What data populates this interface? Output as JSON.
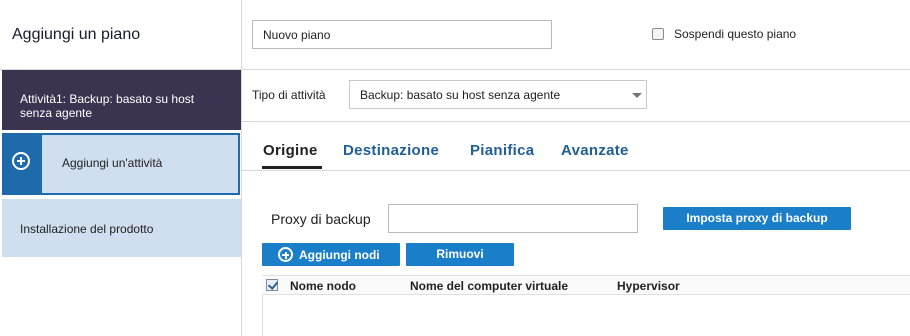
{
  "left_panel": {
    "title": "Aggiungi un piano",
    "task_item": "Attività1: Backup: basato su host senza agente",
    "add_task": "Aggiungi un'attività",
    "install": "Installazione del prodotto"
  },
  "header": {
    "plan_name_value": "Nuovo piano",
    "suspend_label": "Sospendi questo piano",
    "suspend_checked": false
  },
  "task_type": {
    "label": "Tipo di attività",
    "selected": "Backup: basato su host senza agente"
  },
  "tabs": [
    {
      "label": "Origine",
      "active": true
    },
    {
      "label": "Destinazione",
      "active": false
    },
    {
      "label": "Pianifica",
      "active": false
    },
    {
      "label": "Avanzate",
      "active": false
    }
  ],
  "source": {
    "proxy_label": "Proxy di backup",
    "proxy_value": "",
    "proxy_button": "Imposta proxy di backup",
    "add_nodes_button": "Aggiungi nodi",
    "remove_button": "Rimuovi",
    "table": {
      "columns": [
        "Nome nodo",
        "Nome del computer virtuale",
        "Hypervisor"
      ],
      "select_all_checked": true,
      "rows": []
    }
  },
  "colors": {
    "accent": "#1a7ec8",
    "task_item_bg": "#3b3450",
    "panel_item_bg": "#cfdff0",
    "tab_link": "#1f5f96"
  }
}
